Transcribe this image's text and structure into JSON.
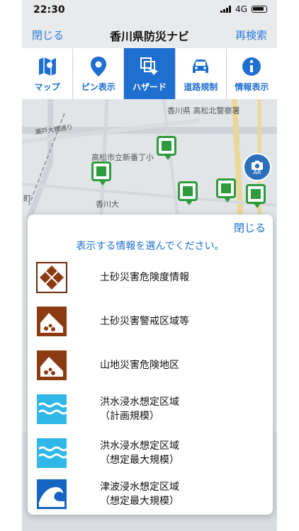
{
  "status": {
    "time": "22:30",
    "network": "4G"
  },
  "nav": {
    "back_label": "閉じる",
    "title": "香川県防災ナビ",
    "research_label": "再検索"
  },
  "tabs": [
    {
      "label": "マップ",
      "icon": "map-icon"
    },
    {
      "label": "ピン表示",
      "icon": "location-pin-icon"
    },
    {
      "label": "ハザード",
      "icon": "layers-icon"
    },
    {
      "label": "道路規制",
      "icon": "car-icon"
    },
    {
      "label": "情報表示",
      "icon": "info-icon"
    }
  ],
  "map": {
    "labels": [
      "香川県 高松北警察署",
      "瀬戸大橋通り",
      "高松市立新番丁小",
      "香川大",
      "町"
    ],
    "ar_label": "AR"
  },
  "sheet": {
    "close_label": "閉じる",
    "prompt": "表示する情報を選んでください。",
    "options": [
      {
        "line1": "土砂災害危険度情報",
        "line2": ""
      },
      {
        "line1": "土砂災害警戒区域等",
        "line2": ""
      },
      {
        "line1": "山地災害危険地区",
        "line2": ""
      },
      {
        "line1": "洪水浸水想定区域",
        "line2": "（計画規模）"
      },
      {
        "line1": "洪水浸水想定区域",
        "line2": "（想定最大規模）"
      },
      {
        "line1": "津波浸水想定区域",
        "line2": "（想定最大規模）"
      }
    ]
  },
  "colors": {
    "accent": "#1f6fd0",
    "pin_green": "#2e9a3e",
    "landslide_brown": "#8a3b12",
    "flood_cyan": "#2fb8e8",
    "tsunami_blue": "#1565c0"
  }
}
